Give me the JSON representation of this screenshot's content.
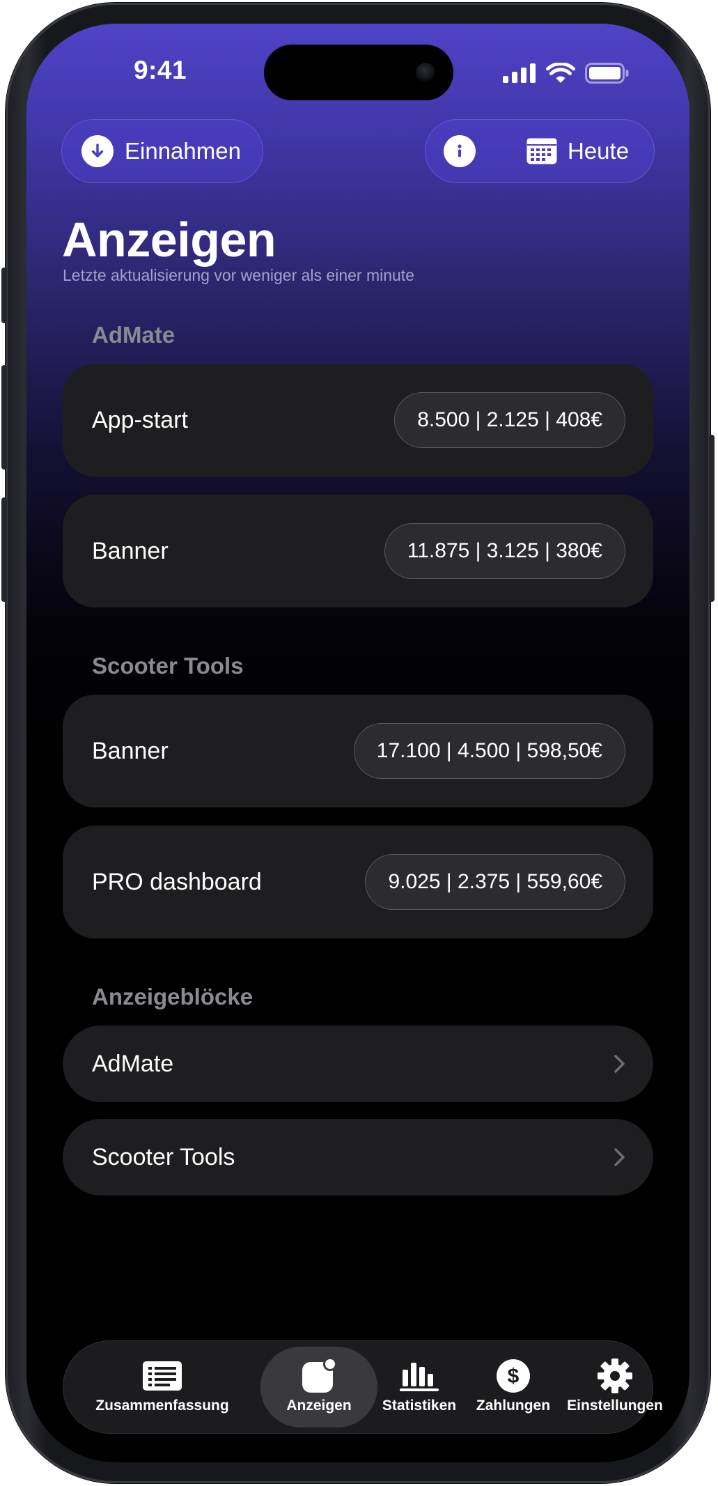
{
  "status_bar": {
    "time": "9:41"
  },
  "header": {
    "income_button_label": "Einnahmen",
    "date_button_label": "Heute"
  },
  "page": {
    "title": "Anzeigen",
    "subtitle": "Letzte aktualisierung vor weniger als einer minute"
  },
  "sections": [
    {
      "title": "AdMate",
      "items": [
        {
          "label": "App-start",
          "stats": "8.500 | 2.125 | 408€"
        },
        {
          "label": "Banner",
          "stats": "11.875 | 3.125 | 380€"
        }
      ]
    },
    {
      "title": "Scooter Tools",
      "items": [
        {
          "label": "Banner",
          "stats": "17.100 | 4.500 | 598,50€"
        },
        {
          "label": "PRO dashboard",
          "stats": "9.025 | 2.375 | 559,60€"
        }
      ]
    }
  ],
  "ad_blocks": {
    "title": "Anzeigeblöcke",
    "items": [
      {
        "label": "AdMate"
      },
      {
        "label": "Scooter Tools"
      }
    ]
  },
  "tabbar": {
    "items": [
      {
        "label": "Zusammenfassung",
        "icon": "list-icon"
      },
      {
        "label": "Anzeigen",
        "icon": "ads-icon",
        "active": true
      },
      {
        "label": "Statistiken",
        "icon": "chart-icon"
      },
      {
        "label": "Zahlungen",
        "icon": "dollar-icon"
      },
      {
        "label": "Einstellungen",
        "icon": "gear-icon"
      }
    ]
  },
  "colors": {
    "accent": "#4f43c7",
    "card_background": "#1e1e20",
    "chip_background": "#2c2c2f",
    "section_header": "#8a8a92"
  }
}
